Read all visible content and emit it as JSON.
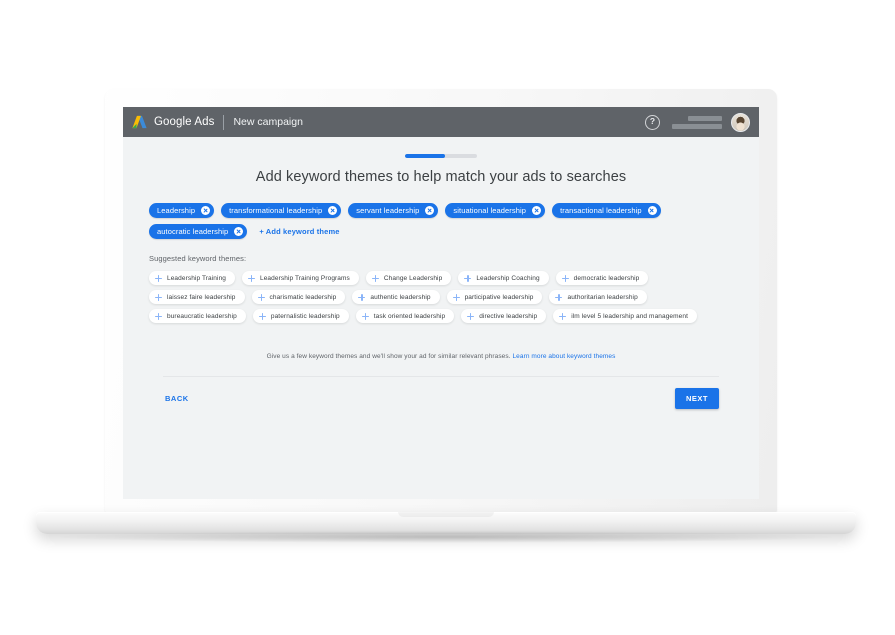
{
  "header": {
    "brand": "Google Ads",
    "page": "New campaign",
    "help_icon": "?",
    "accent_color": "#1a73e8",
    "bar_color": "#5f6368"
  },
  "progress": {
    "percent": 55
  },
  "main": {
    "title": "Add keyword themes to help match your ads to searches",
    "selected_chips": [
      "Leadership",
      "transformational leadership",
      "servant leadership",
      "situational leadership",
      "transactional leadership",
      "autocratic leadership"
    ],
    "add_keyword_theme": "+ Add keyword theme",
    "suggested_label": "Suggested keyword themes:",
    "suggested_chips": [
      "Leadership Training",
      "Leadership Training Programs",
      "Change Leadership",
      "Leadership Coaching",
      "democratic leadership",
      "laissez faire leadership",
      "charismatic leadership",
      "authentic leadership",
      "participative leadership",
      "authoritarian leadership",
      "bureaucratic leadership",
      "paternalistic leadership",
      "task oriented leadership",
      "directive leadership",
      "ilm level 5 leadership and management"
    ],
    "helper_text": "Give us a few keyword themes and we'll show your ad for similar relevant phrases.",
    "helper_link": "Learn more about keyword themes"
  },
  "footer": {
    "back_label": "BACK",
    "next_label": "NEXT"
  }
}
